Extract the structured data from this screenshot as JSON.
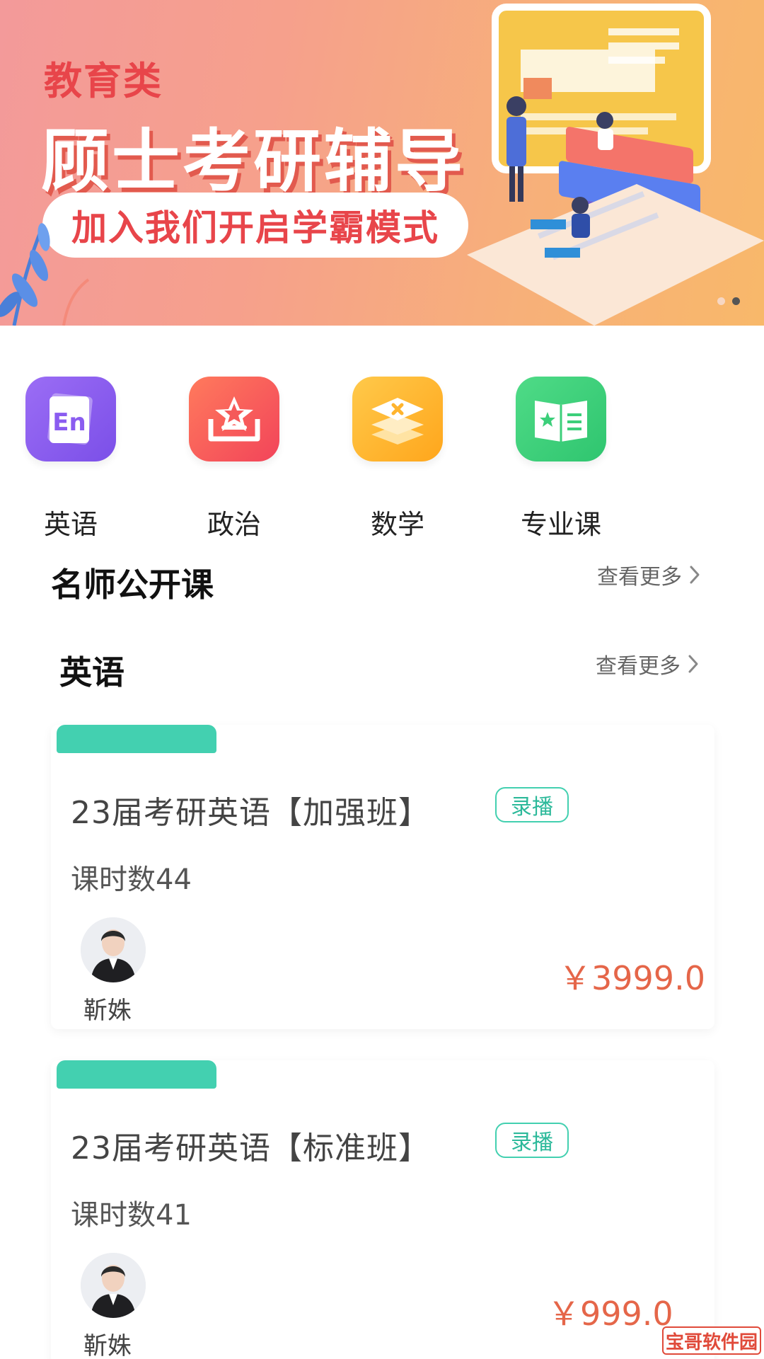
{
  "banner": {
    "tag": "教育类",
    "headline": "顾士考研辅导",
    "slogan": "加入我们开启学霸模式",
    "carousel": {
      "count": 2,
      "active_index": 1
    }
  },
  "categories": [
    {
      "label": "英语",
      "icon": "english-book-icon",
      "color": "#8a5cf0"
    },
    {
      "label": "政治",
      "icon": "star-tray-icon",
      "color": "#f55a5a"
    },
    {
      "label": "数学",
      "icon": "math-layers-icon",
      "color": "#ffb42e"
    },
    {
      "label": "专业课",
      "icon": "open-book-star-icon",
      "color": "#3ccf7a"
    }
  ],
  "featured": {
    "title": "名师公开课",
    "more": "查看更多"
  },
  "english_section": {
    "title": "英语",
    "more": "查看更多"
  },
  "courses": [
    {
      "title": "23届考研英语【加强班】",
      "badge": "录播",
      "hours": "课时数44",
      "teacher": "靳姝",
      "price": "￥3999.0"
    },
    {
      "title": "23届考研英语【标准班】",
      "badge": "录播",
      "hours": "课时数41",
      "teacher": "靳姝",
      "price": "￥999.0"
    }
  ],
  "watermark": "宝哥软件园",
  "colors": {
    "accent_teal": "#43d0b0",
    "price_red": "#e56649",
    "banner_red": "#e8454a"
  }
}
